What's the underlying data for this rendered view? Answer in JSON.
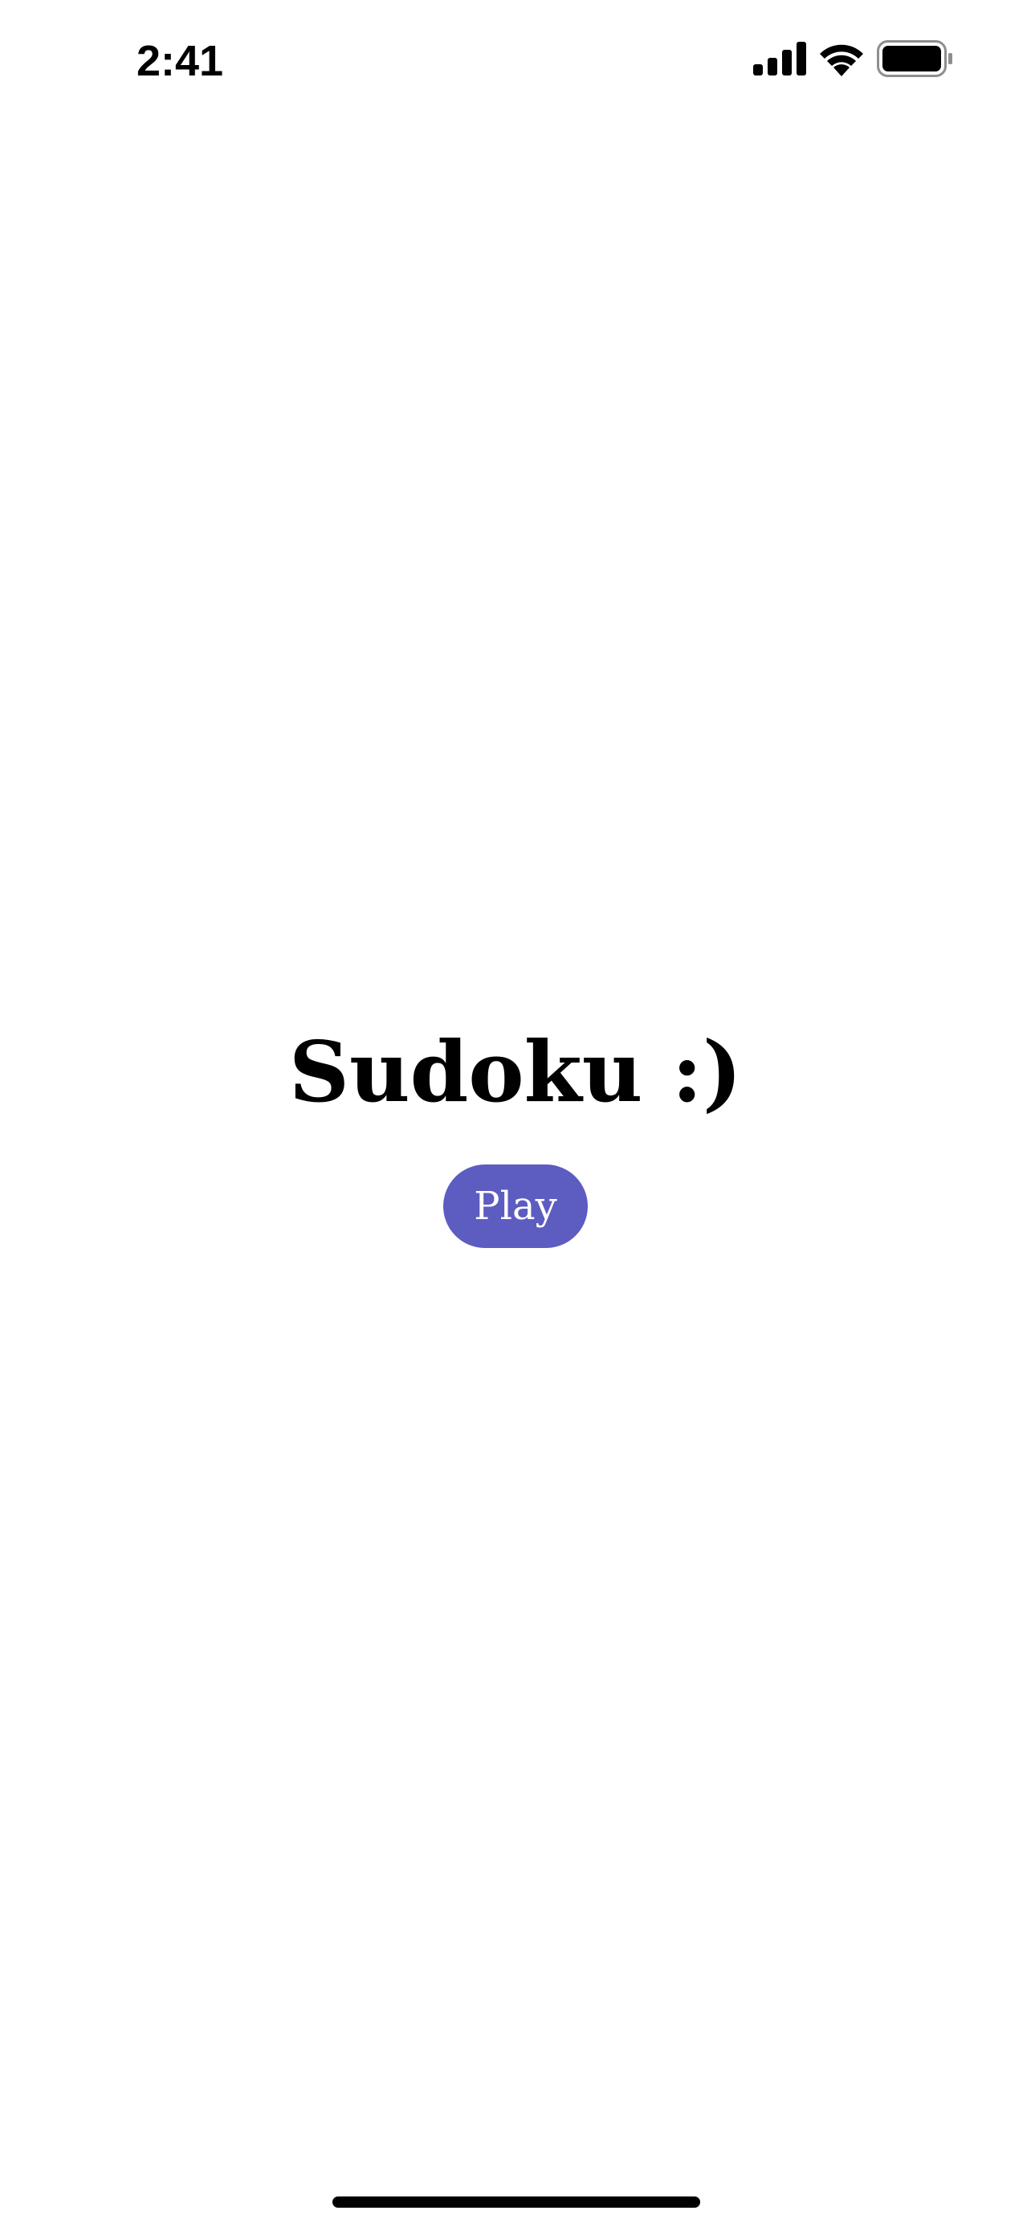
{
  "status_bar": {
    "time": "2:41",
    "icons": [
      "cellular-signal-icon",
      "wifi-icon",
      "battery-icon"
    ]
  },
  "main": {
    "title": "Sudoku :)",
    "play_label": "Play"
  },
  "colors": {
    "accent": "#5d5cc1",
    "background": "#ffffff",
    "text": "#000000"
  }
}
